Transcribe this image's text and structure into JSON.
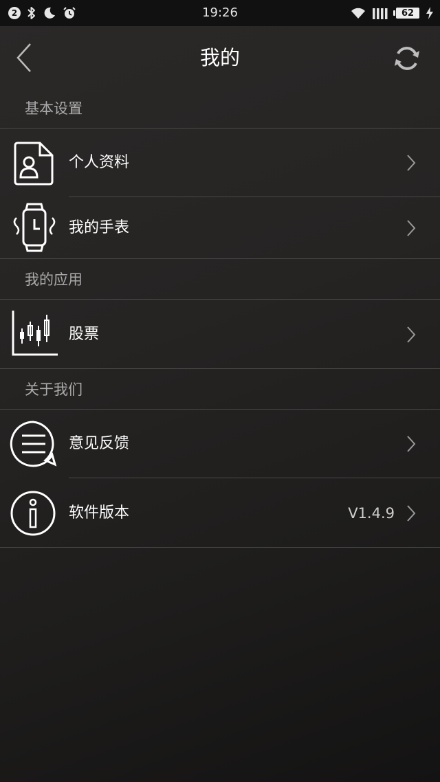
{
  "status_bar": {
    "notification_count": "2",
    "time": "19:26",
    "battery": "62",
    "icons_left": [
      "bluetooth-icon",
      "moon-icon",
      "alarm-icon"
    ],
    "icons_right": [
      "wifi-icon",
      "signal-icon",
      "battery-icon",
      "charging-icon"
    ]
  },
  "header": {
    "title": "我的",
    "back_icon": "chevron-left-icon",
    "refresh_icon": "refresh-icon"
  },
  "sections": [
    {
      "title": "基本设置",
      "items": [
        {
          "label": "个人资料",
          "icon": "profile-document-icon"
        },
        {
          "label": "我的手表",
          "icon": "smartwatch-icon"
        }
      ]
    },
    {
      "title": "我的应用",
      "items": [
        {
          "label": "股票",
          "icon": "candlestick-chart-icon"
        }
      ]
    },
    {
      "title": "关于我们",
      "items": [
        {
          "label": "意见反馈",
          "icon": "feedback-bubble-icon"
        },
        {
          "label": "软件版本",
          "icon": "info-icon",
          "value": "V1.4.9"
        }
      ]
    }
  ],
  "colors": {
    "background": "#252322",
    "status_bar": "#111111",
    "divider": "#4a4948",
    "section_text": "#aaaaaa",
    "text": "#ffffff"
  }
}
